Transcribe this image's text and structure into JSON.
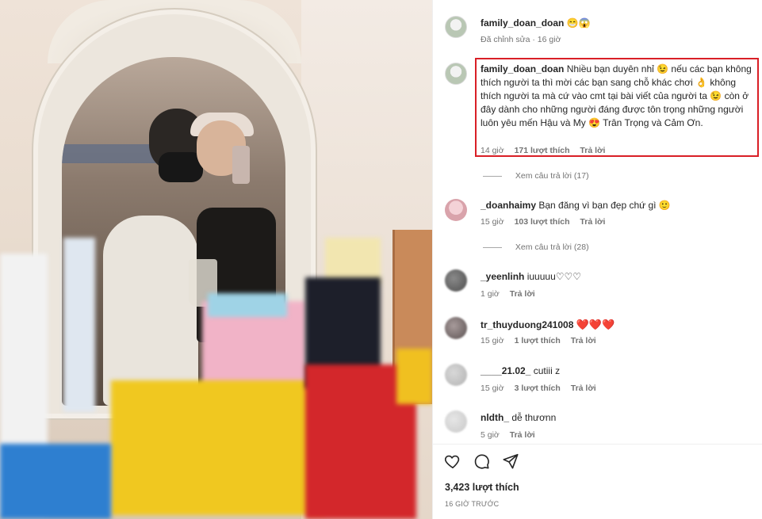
{
  "post": {
    "author": "family_doan_doan",
    "caption_emoji": "😁😱",
    "edited_meta": "Đã chỉnh sửa · 16 giờ"
  },
  "comments": [
    {
      "user": "family_doan_doan",
      "text": "Nhiều bạn duyên nhỉ 😉 nếu các bạn không thích người ta thì mời các bạn sang chỗ khác chơi 👌 không thích người ta mà cứ vào cmt tại bài viết của người ta 😉 còn ở đây dành cho những người đáng được tôn trọng những người luôn yêu mến Hậu và My 😍 Trân Trọng và Cảm Ơn.",
      "time": "14 giờ",
      "likes": "171 lượt thích",
      "reply": "Trả lời",
      "view_replies": "Xem câu trả lời (17)"
    },
    {
      "user": "_doanhaimy",
      "text": "Bạn đăng vì bạn đẹp chứ gì 🙂",
      "time": "15 giờ",
      "likes": "103 lượt thích",
      "reply": "Trả lời",
      "view_replies": "Xem câu trả lời (28)"
    },
    {
      "user": "_yeenlinh",
      "text": "iuuuuu♡♡♡",
      "time": "1 giờ",
      "reply": "Trả lời"
    },
    {
      "user": "tr_thuyduong241008",
      "text": "❤️❤️❤️",
      "time": "15 giờ",
      "likes": "1 lượt thích",
      "reply": "Trả lời"
    },
    {
      "user": "____21.02_",
      "text": "cutiii z",
      "time": "15 giờ",
      "likes": "3 lượt thích",
      "reply": "Trả lời"
    },
    {
      "user": "nldth_",
      "text": "dễ thươnn",
      "time": "5 giờ",
      "reply": "Trả lời"
    }
  ],
  "footer": {
    "likes": "3,423 lượt thích",
    "time": "16 GIỜ TRƯỚC"
  },
  "icons": {
    "like": "heart-outline-icon",
    "comment": "comment-bubble-icon",
    "share": "paper-plane-icon"
  },
  "colors": {
    "highlight": "#d91f26",
    "heart": "#e0141e"
  }
}
